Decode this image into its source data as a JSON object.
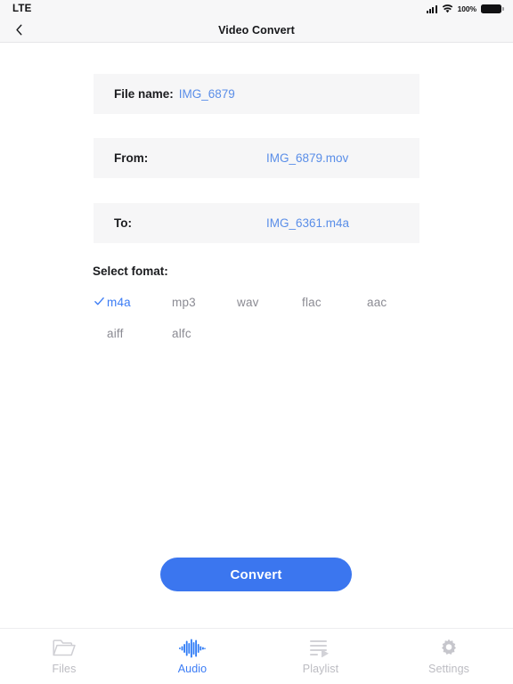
{
  "status_bar": {
    "carrier": "LTE",
    "battery_percent": "100%",
    "signal_icon": "cellular-signal-icon",
    "wifi_icon": "wifi-icon",
    "battery_icon": "battery-full-icon"
  },
  "nav": {
    "title": "Video Convert",
    "back_icon": "chevron-left-icon"
  },
  "info_rows": [
    {
      "label": "File name:",
      "value": "IMG_6879"
    },
    {
      "label": "From:",
      "value": "IMG_6879.mov"
    },
    {
      "label": "To:",
      "value": "IMG_6361.m4a"
    }
  ],
  "format_section": {
    "label": "Select fomat:",
    "selected": "m4a",
    "check_icon": "check-icon",
    "options": [
      {
        "label": "m4a",
        "selected": true
      },
      {
        "label": "mp3",
        "selected": false
      },
      {
        "label": "wav",
        "selected": false
      },
      {
        "label": "flac",
        "selected": false
      },
      {
        "label": "aac",
        "selected": false
      },
      {
        "label": "aiff",
        "selected": false
      },
      {
        "label": "alfc",
        "selected": false
      }
    ]
  },
  "action": {
    "convert_label": "Convert"
  },
  "tabbar": {
    "active": "Audio",
    "items": [
      {
        "label": "Files",
        "icon": "folder-icon",
        "active": false
      },
      {
        "label": "Audio",
        "icon": "waveform-icon",
        "active": true
      },
      {
        "label": "Playlist",
        "icon": "playlist-icon",
        "active": false
      },
      {
        "label": "Settings",
        "icon": "gear-icon",
        "active": false
      }
    ]
  },
  "colors": {
    "accent": "#3b7cf5",
    "button": "#3b76ef",
    "value_text": "#5a8ee8",
    "card_bg": "#f6f6f7",
    "inactive": "#bcbcc2"
  }
}
